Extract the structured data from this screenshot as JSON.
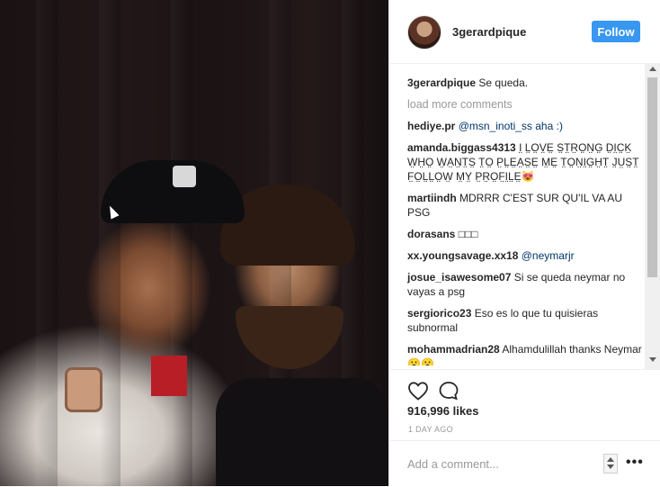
{
  "post": {
    "username": "3gerardpique",
    "follow_label": "Follow",
    "likes": "916,996 likes",
    "time": "1 DAY AGO",
    "add_comment_placeholder": "Add a comment...",
    "more_icon": "more-options-icon",
    "accent_color": "#3897f0"
  },
  "caption": {
    "user": "3gerardpique",
    "text": "Se queda."
  },
  "load_more": "load more comments",
  "comments": [
    {
      "user": "hediye.pr",
      "text": "@msn_inoti_ss aha :)"
    },
    {
      "user": "amanda.biggass4313",
      "text": "I̤ L̤O̤V̤E̤ S̤T̤R̤O̤N̤G̤ D̤I̤C̤K̤ W̤H̤O̤ W̤A̤N̤T̤S̤ T̤O̤ P̤L̤E̤A̤S̤E̤ M̤E̤ T̤O̤N̤I̤G̤H̤T̤ J̤ṲS̤T̤ F̤O̤L̤L̤O̤W̤ M̤Y̤ P̤R̤O̤F̤I̤L̤E̤😻"
    },
    {
      "user": "martiindh",
      "text": "MDRRR C'EST SUR QU'IL VA AU PSG"
    },
    {
      "user": "dorasans",
      "text": "□□□"
    },
    {
      "user": "xx.youngsavage.xx18",
      "text": "@neymarjr"
    },
    {
      "user": "josue_isawesome07",
      "text": "Si se queda neymar no vayas a psg"
    },
    {
      "user": "sergiorico23",
      "text": "Eso es lo que tu quisieras subnormal"
    },
    {
      "user": "mohammadrian28",
      "text": "Alhamdulillah thanks Neymar😮😮"
    }
  ]
}
